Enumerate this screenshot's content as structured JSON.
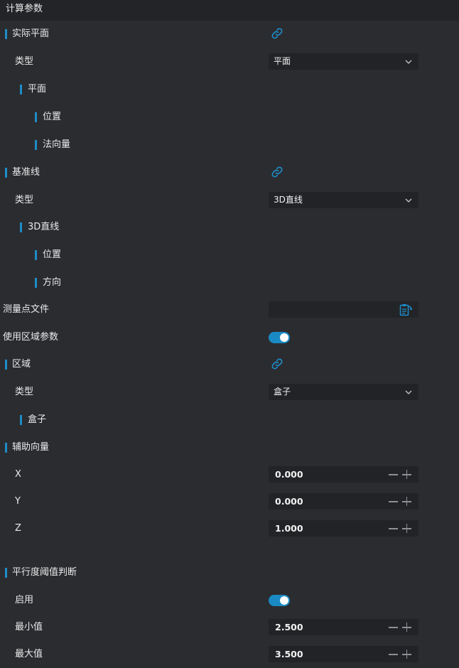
{
  "header": {
    "title": "计算参数"
  },
  "actual_plane": {
    "title": "实际平面",
    "type_label": "类型",
    "type_value": "平面",
    "sub_title": "平面",
    "position_label": "位置",
    "normal_label": "法向量"
  },
  "baseline": {
    "title": "基准线",
    "type_label": "类型",
    "type_value": "3D直线",
    "sub_title": "3D直线",
    "position_label": "位置",
    "direction_label": "方向"
  },
  "measure_file": {
    "label": "测量点文件",
    "value": ""
  },
  "use_region": {
    "label": "使用区域参数",
    "enabled": true
  },
  "region": {
    "title": "区域",
    "type_label": "类型",
    "type_value": "盒子",
    "sub_title": "盒子"
  },
  "aux_vector": {
    "title": "辅助向量",
    "x_label": "X",
    "x_value": "0.000",
    "y_label": "Y",
    "y_value": "0.000",
    "z_label": "Z",
    "z_value": "1.000"
  },
  "parallel": {
    "title": "平行度阈值判断",
    "enable_label": "启用",
    "enabled": true,
    "min_label": "最小值",
    "min_value": "2.500",
    "max_label": "最大值",
    "max_value": "3.500"
  },
  "colors": {
    "accent": "#1e8cc8",
    "background": "#2b2c30",
    "field": "#222326"
  },
  "icons": {
    "link": "link-icon",
    "chevron": "chevron-down-icon",
    "file": "file-refresh-icon"
  }
}
